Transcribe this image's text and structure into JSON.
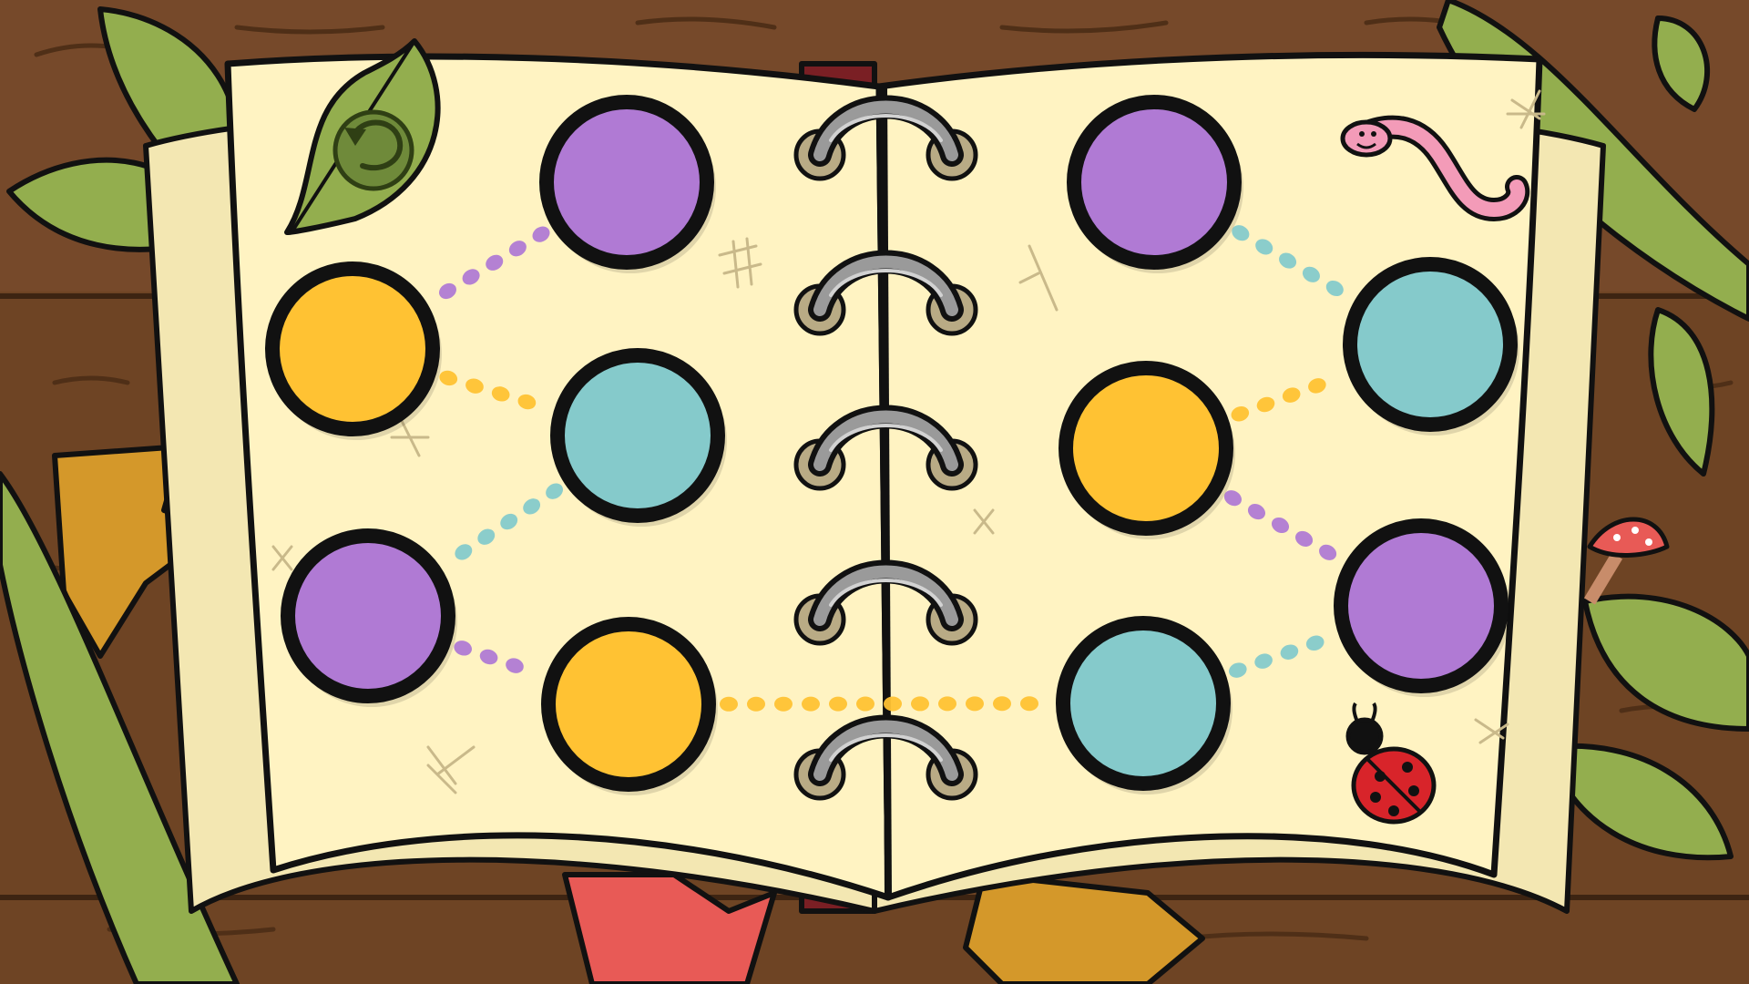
{
  "game": {
    "title": "",
    "undo_button": {
      "icon": "undo-arrow-icon"
    },
    "colors": {
      "purple": "#b07ad4",
      "yellow": "#ffc233",
      "teal": "#85cacb",
      "paper": "#fff3c2",
      "wood": "#6e4424",
      "wood_line": "#4f2f17",
      "outline": "#111111",
      "leaf": "#93ae4e",
      "leaf_dark": "#5f7a2b",
      "ring": "#9a9a9a",
      "spine_red": "#7a1f24"
    },
    "left_page": {
      "nodes": [
        {
          "id": "L1",
          "color": "purple"
        },
        {
          "id": "L2",
          "color": "yellow"
        },
        {
          "id": "L3",
          "color": "teal"
        },
        {
          "id": "L4",
          "color": "purple"
        },
        {
          "id": "L5",
          "color": "yellow"
        }
      ]
    },
    "right_page": {
      "nodes": [
        {
          "id": "R1",
          "color": "purple"
        },
        {
          "id": "R2",
          "color": "teal"
        },
        {
          "id": "R3",
          "color": "yellow"
        },
        {
          "id": "R4",
          "color": "purple"
        },
        {
          "id": "R5",
          "color": "teal"
        }
      ]
    },
    "links": [
      {
        "from": "L1",
        "to": "L2",
        "color": "purple"
      },
      {
        "from": "L2",
        "to": "L3",
        "color": "yellow"
      },
      {
        "from": "L3",
        "to": "L4",
        "color": "teal"
      },
      {
        "from": "L4",
        "to": "L5",
        "color": "purple"
      },
      {
        "from": "L5",
        "to": "R5",
        "color": "yellow"
      },
      {
        "from": "R1",
        "to": "R2",
        "color": "teal"
      },
      {
        "from": "R3",
        "to": "R2",
        "color": "yellow"
      },
      {
        "from": "R3",
        "to": "R4",
        "color": "purple"
      },
      {
        "from": "R5",
        "to": "R4",
        "color": "teal"
      }
    ],
    "decorations": [
      "worm-icon",
      "ladybug-icon",
      "mushroom-icon",
      "leaf-icon"
    ]
  }
}
